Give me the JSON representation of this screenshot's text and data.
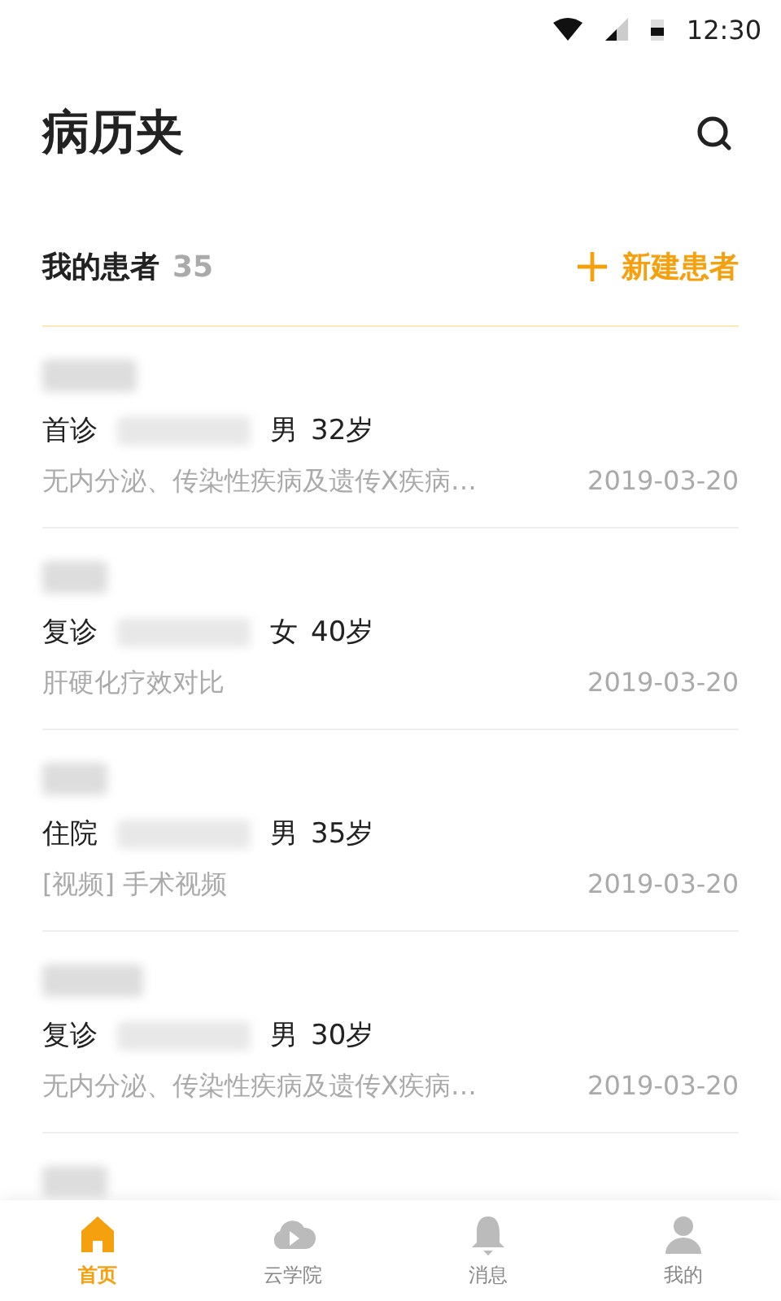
{
  "status_bar": {
    "time": "12:30"
  },
  "title": "病历夹",
  "section": {
    "label": "我的患者",
    "count": "35",
    "action": "新建患者"
  },
  "patients": [
    {
      "kind": "full",
      "visit": "首诊",
      "gender": "男",
      "age": "32岁",
      "summary": "无内分泌、传染性疾病及遗传X疾病…",
      "date": "2019-03-20"
    },
    {
      "kind": "full",
      "visit": "复诊",
      "gender": "女",
      "age": "40岁",
      "summary": "肝硬化疗效对比",
      "date": "2019-03-20"
    },
    {
      "kind": "full",
      "visit": "住院",
      "gender": "男",
      "age": "35岁",
      "summary": "[视频] 手术视频",
      "date": "2019-03-20"
    },
    {
      "kind": "full",
      "visit": "复诊",
      "gender": "男",
      "age": "30岁",
      "summary": "无内分泌、传染性疾病及遗传X疾病…",
      "date": "2019-03-20"
    },
    {
      "kind": "cut"
    }
  ],
  "tabs": [
    {
      "label": "首页",
      "selected": true
    },
    {
      "label": "云学院",
      "selected": false
    },
    {
      "label": "消息",
      "selected": false
    },
    {
      "label": "我的",
      "selected": false
    }
  ]
}
